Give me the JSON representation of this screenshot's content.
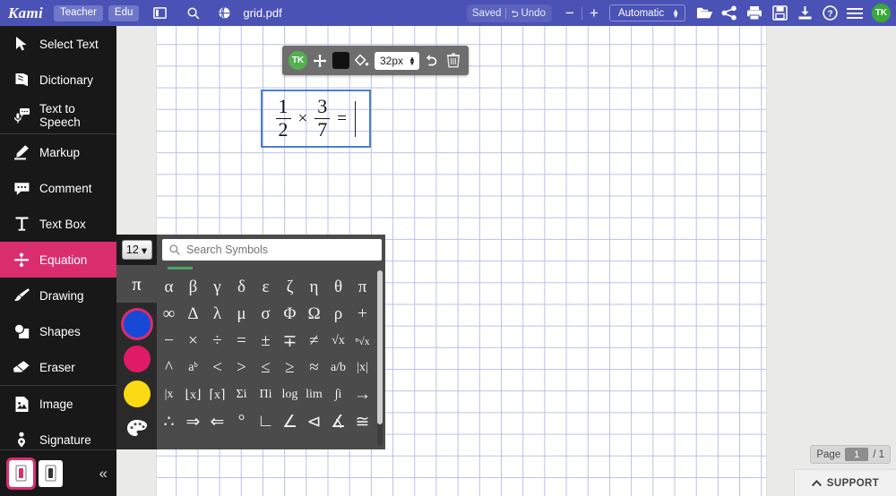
{
  "app": {
    "brand": "Kami",
    "badges": [
      "Teacher",
      "Edu"
    ],
    "filename": "grid.pdf"
  },
  "topbar": {
    "panel_toggle_icon": "sidebar-panel-icon",
    "search_icon": "search-icon",
    "globe_icon": "globe-icon",
    "saved_label": "Saved",
    "undo_label": "Undo",
    "zoom_out_label": "−",
    "zoom_in_label": "+",
    "zoom_value": "Automatic",
    "actions": [
      {
        "name": "open-folder-button",
        "icon": "folder-icon"
      },
      {
        "name": "share-button",
        "icon": "share-icon"
      },
      {
        "name": "print-button",
        "icon": "printer-icon"
      },
      {
        "name": "save-button",
        "icon": "floppy-disk-icon"
      },
      {
        "name": "download-button",
        "icon": "download-icon"
      },
      {
        "name": "help-button",
        "icon": "question-circle-icon"
      },
      {
        "name": "menu-button",
        "icon": "hamburger-menu-icon"
      }
    ],
    "avatar_initials": "TK"
  },
  "sidebar": {
    "items": [
      {
        "label": "Select Text",
        "icon": "cursor-arrow-icon",
        "active": false
      },
      {
        "label": "Dictionary",
        "icon": "book-icon",
        "active": false
      },
      {
        "label": "Text to Speech",
        "icon": "microphone-speech-icon",
        "active": false
      },
      {
        "label": "Markup",
        "icon": "highlighter-icon",
        "active": false
      },
      {
        "label": "Comment",
        "icon": "comment-bubble-icon",
        "active": false
      },
      {
        "label": "Text Box",
        "icon": "text-box-icon",
        "active": false
      },
      {
        "label": "Equation",
        "icon": "division-sign-icon",
        "active": true
      },
      {
        "label": "Drawing",
        "icon": "pen-brush-icon",
        "active": false
      },
      {
        "label": "Shapes",
        "icon": "shapes-icon",
        "active": false
      },
      {
        "label": "Eraser",
        "icon": "eraser-icon",
        "active": false
      },
      {
        "label": "Image",
        "icon": "image-icon",
        "active": false
      },
      {
        "label": "Signature",
        "icon": "signature-icon",
        "active": false
      }
    ],
    "page_modes": [
      {
        "name": "single-page-mode",
        "selected": true
      },
      {
        "name": "continuous-page-mode",
        "selected": false
      }
    ],
    "collapse_icon": "double-chevron-left-icon",
    "active_color": "#d92d6e"
  },
  "equation_toolbar": {
    "avatar_initials": "TK",
    "move_icon": "move-handle-icon",
    "color_swatch": "#111111",
    "fill_icon": "color-fill-icon",
    "font_size": "32px",
    "undo_icon": "undo-arrow-icon",
    "delete_icon": "trash-can-icon"
  },
  "equation": {
    "fraction1": {
      "numerator": "1",
      "denominator": "2"
    },
    "operator": "×",
    "fraction2": {
      "numerator": "3",
      "denominator": "7"
    },
    "equals": "=",
    "selection_color": "#4a7fd1"
  },
  "symbol_panel": {
    "font_size": "12",
    "font_size_caret": "▾",
    "search_placeholder": "Search Symbols",
    "search_value": "",
    "search_icon": "search-icon",
    "category_tab": "π",
    "colors": [
      {
        "name": "color-blue",
        "hex": "#1749d6",
        "selected": true
      },
      {
        "name": "color-pink",
        "hex": "#e01a67",
        "selected": false
      },
      {
        "name": "color-yellow",
        "hex": "#fbd914",
        "selected": false
      }
    ],
    "palette_icon": "color-palette-icon",
    "symbols": [
      "α",
      "β",
      "γ",
      "δ",
      "ε",
      "ζ",
      "η",
      "θ",
      "π",
      "∞",
      "Δ",
      "λ",
      "μ",
      "σ",
      "Φ",
      "Ω",
      "ρ",
      "+",
      "−",
      "×",
      "÷",
      "=",
      "±",
      "∓",
      "≠",
      "√x",
      "ⁿ√x",
      "^",
      "aᵇ",
      "<",
      ">",
      "≤",
      "≥",
      "≈",
      "a/b",
      "|x|",
      "|x",
      "⌊x⌋",
      "⌈x⌉",
      "Σi",
      "Πi",
      "log",
      "lim",
      "∫i",
      "→",
      "∴",
      "⇒",
      "⇐",
      "°",
      "∟",
      "∠",
      "⊲",
      "∡",
      "≅"
    ]
  },
  "footer": {
    "page_label": "Page",
    "page_current": "1",
    "page_total": "/ 1",
    "support_label": "SUPPORT",
    "support_icon": "chevron-up-icon"
  }
}
